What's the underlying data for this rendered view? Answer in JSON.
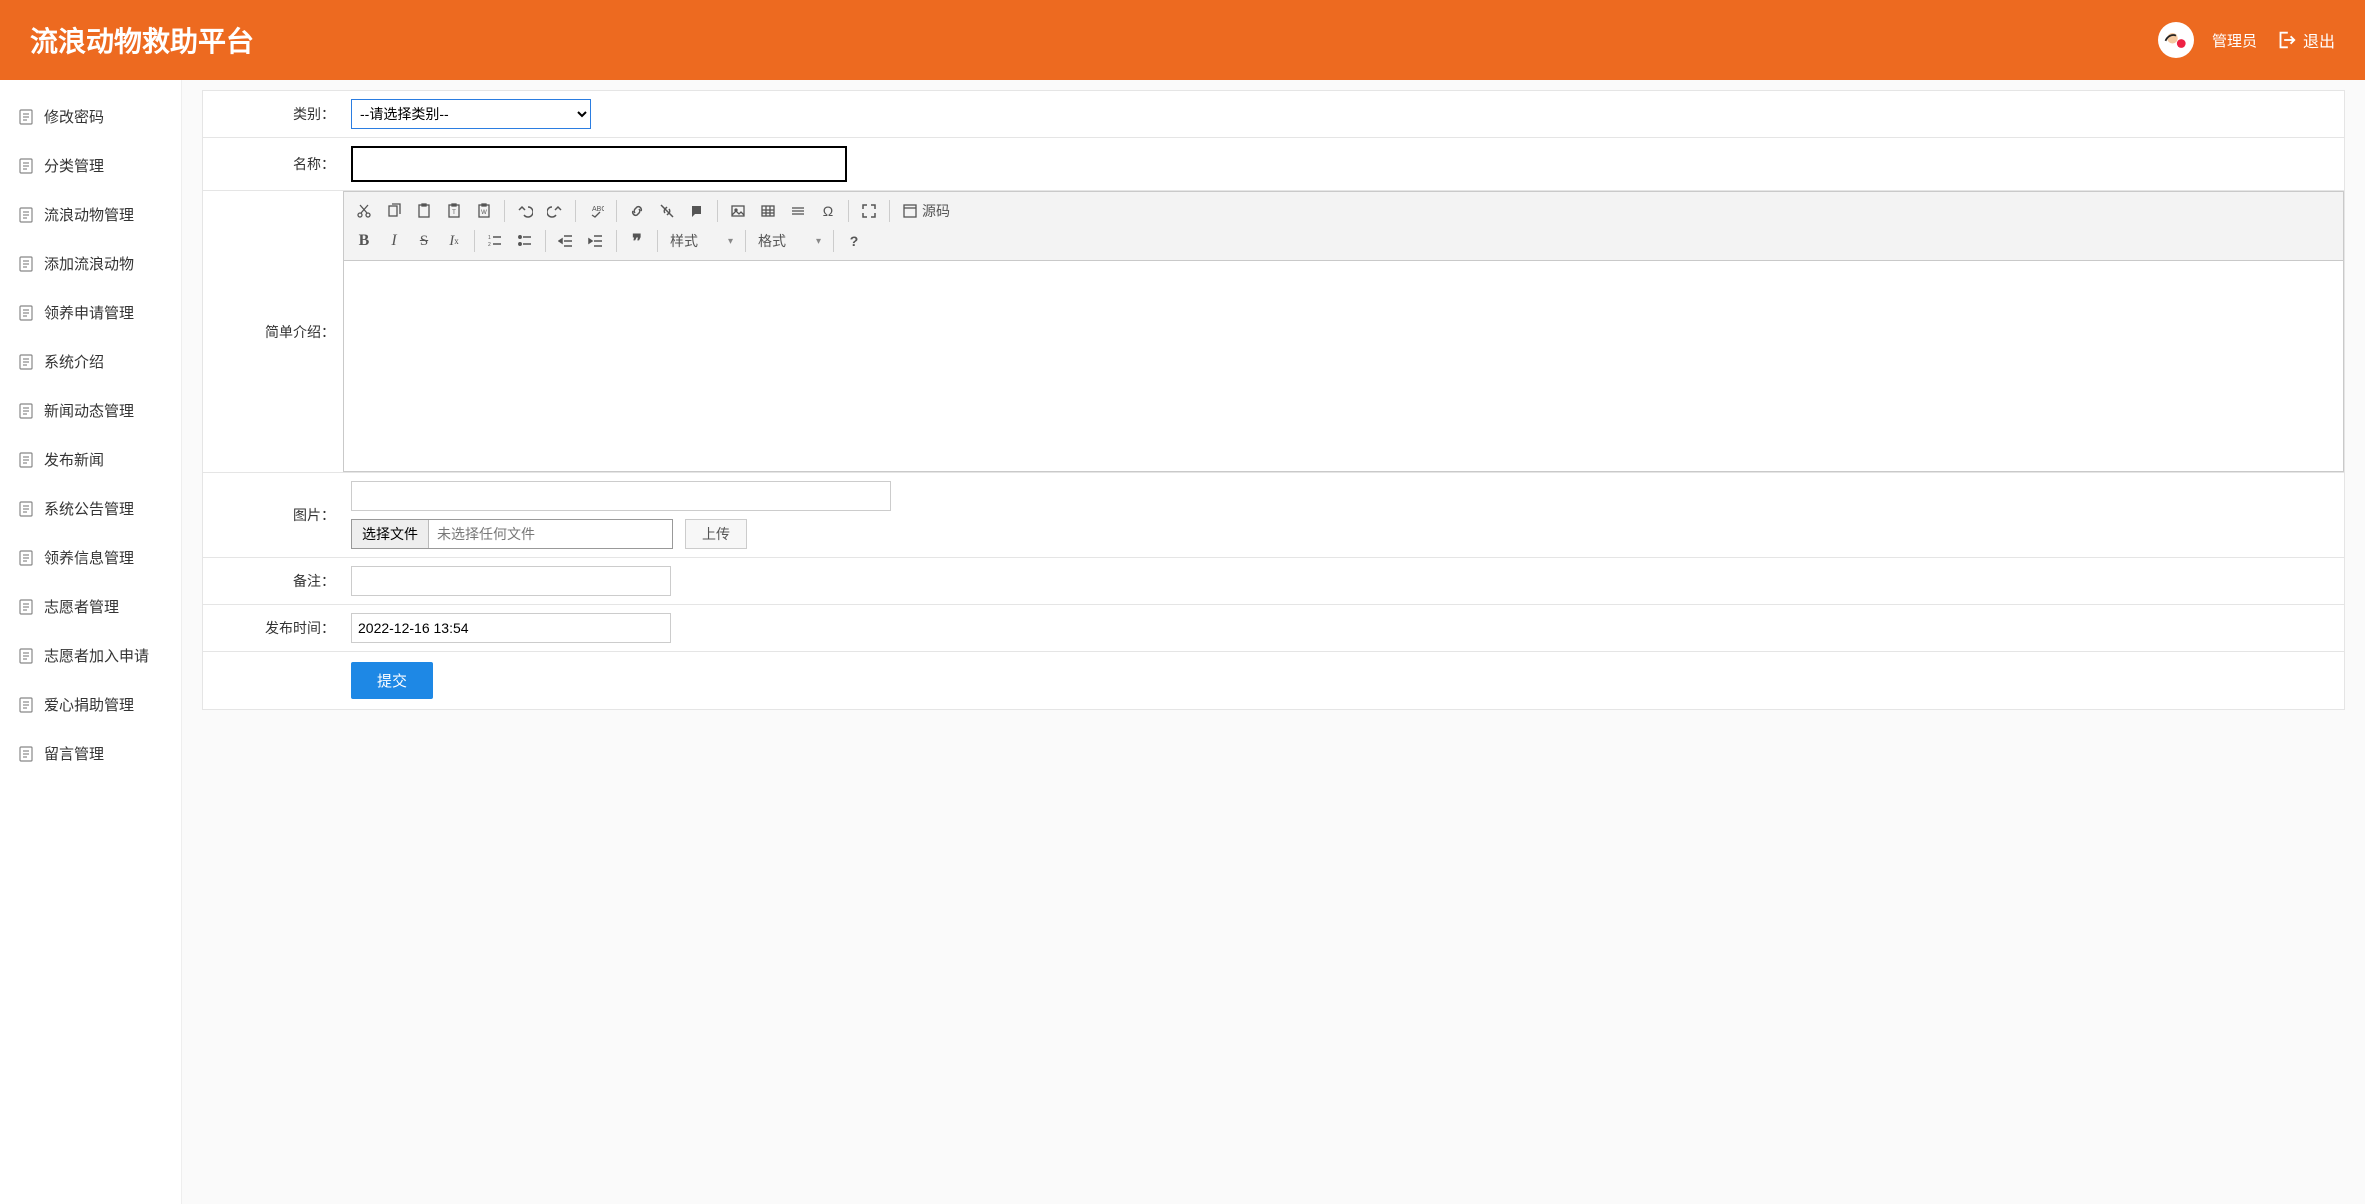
{
  "header": {
    "title": "流浪动物救助平台",
    "user_name": "管理员",
    "logout_label": "退出"
  },
  "sidebar": {
    "items": [
      {
        "label": "修改密码"
      },
      {
        "label": "分类管理"
      },
      {
        "label": "流浪动物管理"
      },
      {
        "label": "添加流浪动物"
      },
      {
        "label": "领养申请管理"
      },
      {
        "label": "系统介绍"
      },
      {
        "label": "新闻动态管理"
      },
      {
        "label": "发布新闻"
      },
      {
        "label": "系统公告管理"
      },
      {
        "label": "领养信息管理"
      },
      {
        "label": "志愿者管理"
      },
      {
        "label": "志愿者加入申请"
      },
      {
        "label": "爱心捐助管理"
      },
      {
        "label": "留言管理"
      }
    ]
  },
  "form": {
    "category": {
      "label": "类别：",
      "placeholder": "--请选择类别--",
      "value": ""
    },
    "name": {
      "label": "名称：",
      "value": ""
    },
    "intro": {
      "label": "简单介绍："
    },
    "image": {
      "label": "图片：",
      "path_value": "",
      "choose_btn": "选择文件",
      "no_file": "未选择任何文件",
      "upload_btn": "上传"
    },
    "remark": {
      "label": "备注：",
      "value": ""
    },
    "publish_time": {
      "label": "发布时间：",
      "value": "2022-12-16 13:54"
    },
    "submit_label": "提交"
  },
  "rte": {
    "style_label": "样式",
    "format_label": "格式",
    "source_label": "源码"
  }
}
